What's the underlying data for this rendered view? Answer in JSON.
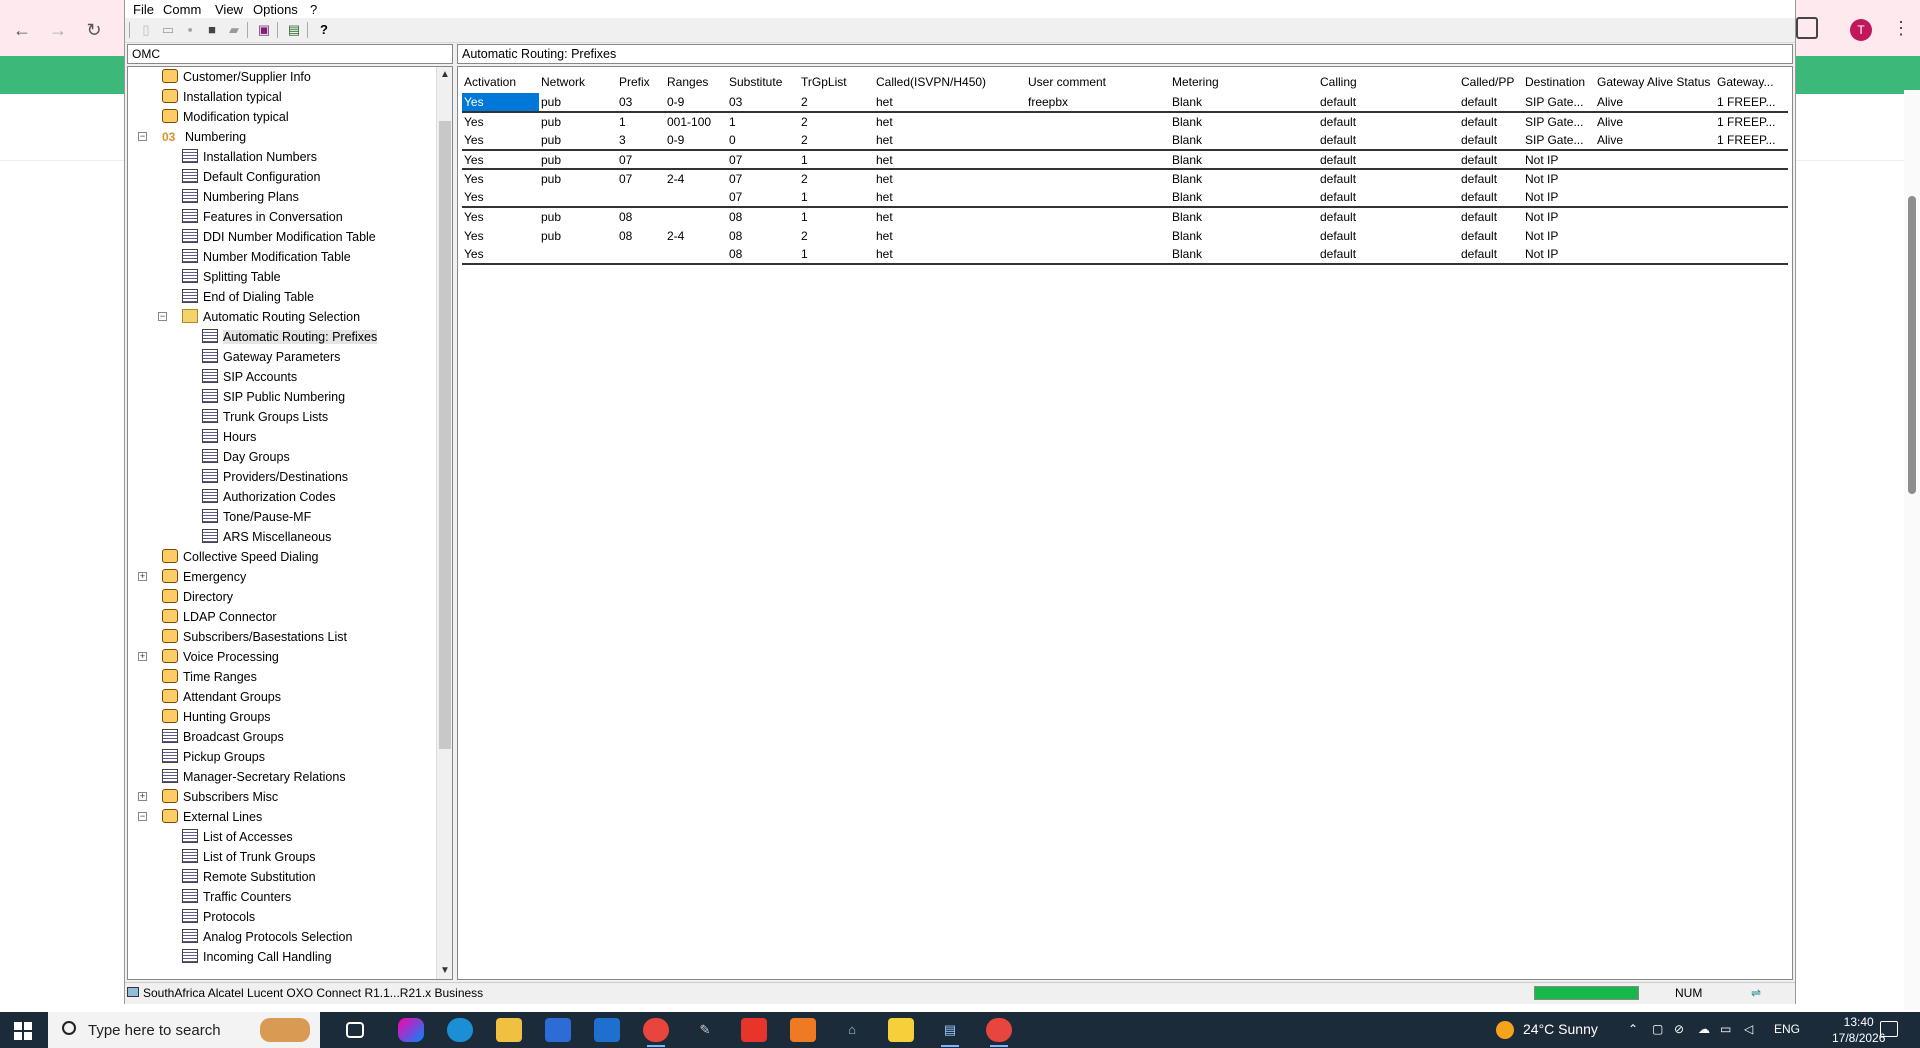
{
  "menu": {
    "items": [
      "File",
      "Comm",
      "View",
      "Options",
      "?"
    ]
  },
  "tree": {
    "header": "OMC",
    "items": [
      {
        "label": "Customer/Supplier Info",
        "level": 1,
        "icon": "customer-info-icon"
      },
      {
        "label": "Installation typical",
        "level": 1,
        "icon": "installation-icon"
      },
      {
        "label": "Modification typical",
        "level": 1,
        "icon": "modification-icon"
      },
      {
        "label": "Numbering",
        "level": 1,
        "icon": "numbering-icon",
        "expanded": true
      },
      {
        "label": "Installation Numbers",
        "level": 2,
        "icon": "table-icon"
      },
      {
        "label": "Default Configuration",
        "level": 2,
        "icon": "table-icon"
      },
      {
        "label": "Numbering Plans",
        "level": 2,
        "icon": "table-icon"
      },
      {
        "label": "Features in Conversation",
        "level": 2,
        "icon": "table-icon"
      },
      {
        "label": "DDI Number Modification Table",
        "level": 2,
        "icon": "table-icon"
      },
      {
        "label": "Number Modification Table",
        "level": 2,
        "icon": "table-icon"
      },
      {
        "label": "Splitting Table",
        "level": 2,
        "icon": "table-icon"
      },
      {
        "label": "End of Dialing Table",
        "level": 2,
        "icon": "table-icon"
      },
      {
        "label": "Automatic Routing Selection",
        "level": 2,
        "icon": "folder-icon",
        "expanded": true
      },
      {
        "label": "Automatic Routing: Prefixes",
        "level": 3,
        "icon": "table-icon",
        "selected": true
      },
      {
        "label": "Gateway Parameters",
        "level": 3,
        "icon": "table-icon"
      },
      {
        "label": "SIP Accounts",
        "level": 3,
        "icon": "table-icon"
      },
      {
        "label": "SIP Public Numbering",
        "level": 3,
        "icon": "table-icon"
      },
      {
        "label": "Trunk Groups Lists",
        "level": 3,
        "icon": "table-icon"
      },
      {
        "label": "Hours",
        "level": 3,
        "icon": "table-icon"
      },
      {
        "label": "Day Groups",
        "level": 3,
        "icon": "table-icon"
      },
      {
        "label": "Providers/Destinations",
        "level": 3,
        "icon": "table-icon"
      },
      {
        "label": "Authorization Codes",
        "level": 3,
        "icon": "table-icon"
      },
      {
        "label": "Tone/Pause-MF",
        "level": 3,
        "icon": "table-icon"
      },
      {
        "label": "ARS Miscellaneous",
        "level": 3,
        "icon": "table-icon"
      },
      {
        "label": "Collective Speed Dialing",
        "level": 1,
        "icon": "speed-dial-icon"
      },
      {
        "label": "Emergency",
        "level": 1,
        "icon": "emergency-icon",
        "collapsed": true
      },
      {
        "label": "Directory",
        "level": 1,
        "icon": "directory-icon"
      },
      {
        "label": "LDAP Connector",
        "level": 1,
        "icon": "ldap-icon"
      },
      {
        "label": "Subscribers/Basestations List",
        "level": 1,
        "icon": "subscriber-icon"
      },
      {
        "label": "Voice Processing",
        "level": 1,
        "icon": "voice-processing-icon",
        "collapsed": true
      },
      {
        "label": "Time Ranges",
        "level": 1,
        "icon": "clock-icon"
      },
      {
        "label": "Attendant Groups",
        "level": 1,
        "icon": "attendant-icon"
      },
      {
        "label": "Hunting Groups",
        "level": 1,
        "icon": "hunting-icon"
      },
      {
        "label": "Broadcast Groups",
        "level": 1,
        "icon": "table-icon"
      },
      {
        "label": "Pickup Groups",
        "level": 1,
        "icon": "table-icon"
      },
      {
        "label": "Manager-Secretary Relations",
        "level": 1,
        "icon": "table-icon"
      },
      {
        "label": "Subscribers Misc",
        "level": 1,
        "icon": "subscribers-misc-icon",
        "collapsed": true
      },
      {
        "label": "External Lines",
        "level": 1,
        "icon": "external-lines-icon",
        "expanded": true
      },
      {
        "label": "List of Accesses",
        "level": 2,
        "icon": "table-icon"
      },
      {
        "label": "List of Trunk Groups",
        "level": 2,
        "icon": "table-icon"
      },
      {
        "label": "Remote Substitution",
        "level": 2,
        "icon": "table-icon"
      },
      {
        "label": "Traffic Counters",
        "level": 2,
        "icon": "table-icon"
      },
      {
        "label": "Protocols",
        "level": 2,
        "icon": "table-icon"
      },
      {
        "label": "Analog Protocols Selection",
        "level": 2,
        "icon": "table-icon"
      },
      {
        "label": "Incoming Call Handling",
        "level": 2,
        "icon": "table-icon"
      }
    ]
  },
  "grid": {
    "title": "Automatic Routing: Prefixes",
    "columns": [
      "Activation",
      "Network",
      "Prefix",
      "Ranges",
      "Substitute",
      "TrGpList",
      "Called(ISVPN/H450)",
      "User comment",
      "Metering",
      "Calling",
      "Called/PP",
      "Destination",
      "Gateway Alive Status",
      "Gateway..."
    ],
    "rows": [
      [
        "Yes",
        "pub",
        "03",
        "0-9",
        "03",
        "2",
        "het",
        "freepbx",
        "Blank",
        "default",
        "default",
        "SIP Gate...",
        "Alive",
        "1 FREEP..."
      ],
      [
        "Yes",
        "pub",
        "1",
        "001-100",
        "1",
        "2",
        "het",
        "",
        "Blank",
        "default",
        "default",
        "SIP Gate...",
        "Alive",
        "1 FREEP..."
      ],
      [
        "Yes",
        "pub",
        "3",
        "0-9",
        "0",
        "2",
        "het",
        "",
        "Blank",
        "default",
        "default",
        "SIP Gate...",
        "Alive",
        "1 FREEP..."
      ],
      [
        "Yes",
        "pub",
        "07",
        "",
        "07",
        "1",
        "het",
        "",
        "Blank",
        "default",
        "default",
        "Not IP",
        "",
        ""
      ],
      [
        "Yes",
        "pub",
        "07",
        "2-4",
        "07",
        "2",
        "het",
        "",
        "Blank",
        "default",
        "default",
        "Not IP",
        "",
        ""
      ],
      [
        "Yes",
        "",
        "",
        "",
        "07",
        "1",
        "het",
        "",
        "Blank",
        "default",
        "default",
        "Not IP",
        "",
        ""
      ],
      [
        "Yes",
        "pub",
        "08",
        "",
        "08",
        "1",
        "het",
        "",
        "Blank",
        "default",
        "default",
        "Not IP",
        "",
        ""
      ],
      [
        "Yes",
        "pub",
        "08",
        "2-4",
        "08",
        "2",
        "het",
        "",
        "Blank",
        "default",
        "default",
        "Not IP",
        "",
        ""
      ],
      [
        "Yes",
        "",
        "",
        "",
        "08",
        "1",
        "het",
        "",
        "Blank",
        "default",
        "default",
        "Not IP",
        "",
        ""
      ]
    ]
  },
  "status": {
    "text": "SouthAfrica Alcatel Lucent OXO Connect R1.1...R21.x Business",
    "num": "NUM"
  },
  "browser": {
    "avatar": "T"
  },
  "taskbar": {
    "search_placeholder": "Type here to search",
    "weather": "24°C  Sunny",
    "lang": "ENG",
    "time": "13:40",
    "date": "17/8/2026"
  },
  "colors": {
    "selection": "#0078d7",
    "progress": "#17b84a",
    "green_banner": "#3cb878"
  }
}
